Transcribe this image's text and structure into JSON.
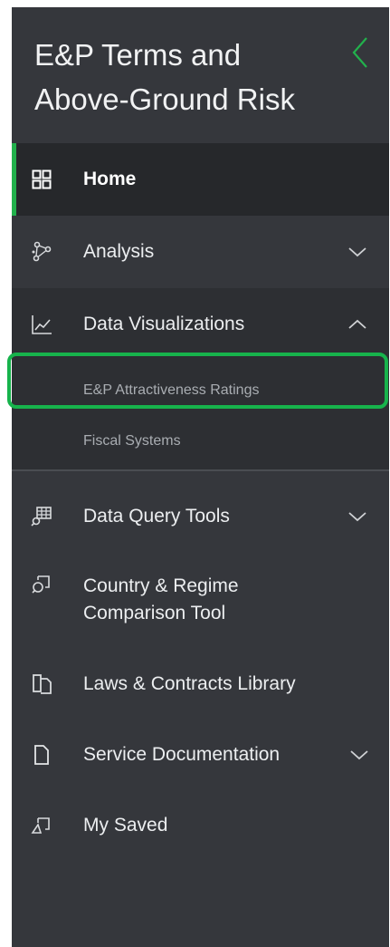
{
  "app": {
    "title": "E&P Terms and Above-Ground Risk"
  },
  "colors": {
    "sidebar_bg": "#35373c",
    "accent": "#22b14c",
    "active_bg": "#26282b",
    "highlight": "#17b34c"
  },
  "nav": {
    "home": {
      "label": "Home",
      "icon": "grid-icon"
    },
    "analysis": {
      "label": "Analysis",
      "icon": "network-icon"
    },
    "data_visualizations": {
      "label": "Data Visualizations",
      "icon": "line-chart-icon",
      "expanded": true,
      "children": [
        {
          "label": "E&P Attractiveness Ratings"
        },
        {
          "label": "Fiscal Systems"
        }
      ]
    },
    "data_query_tools": {
      "label": "Data Query Tools",
      "icon": "table-tool-icon"
    },
    "country_regime": {
      "label_line1": "Country & Regime",
      "label_line2": "Comparison Tool",
      "icon": "compare-icon"
    },
    "laws_contracts": {
      "label": "Laws & Contracts Library",
      "icon": "library-icon"
    },
    "service_docs": {
      "label": "Service Documentation",
      "icon": "document-icon"
    },
    "my_saved": {
      "label": "My Saved",
      "icon": "saved-icon"
    }
  }
}
